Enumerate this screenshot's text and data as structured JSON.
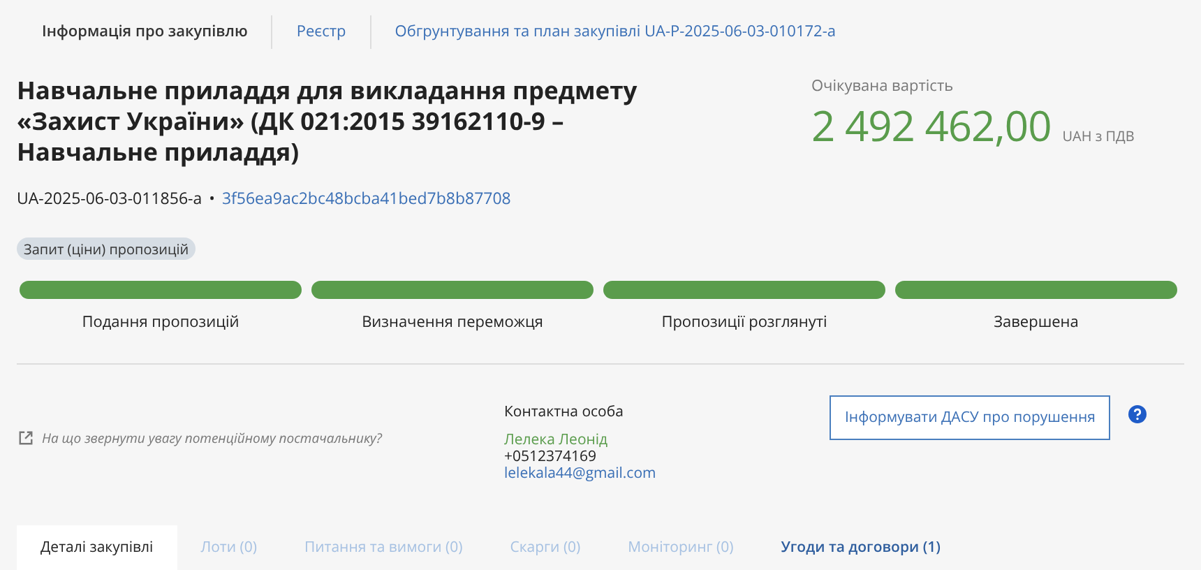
{
  "top_tabs": [
    {
      "label": "Інформація про закупівлю",
      "selected": true
    },
    {
      "label": "Реєстр",
      "selected": false
    },
    {
      "label": "Обгрунтування та план закупівлі UA-P-2025-06-03-010172-a",
      "selected": false
    }
  ],
  "title": "Навчальне приладдя для викладання предмету «Захист України» (ДК 021:2015 39162110-9 – Навчальне приладдя)",
  "tender_id": "UA-2025-06-03-011856-a",
  "separator": "•",
  "hash": "3f56ea9ac2bc48bcba41bed7b8b87708",
  "procedure": "Запит (ціни) пропозицій",
  "value": {
    "label": "Очікувана вартість",
    "amount": "2 492 462,00",
    "currency": "UAH з ПДВ"
  },
  "stages": [
    {
      "label": "Подання пропозицій",
      "done": true
    },
    {
      "label": "Визначення переможця",
      "done": true
    },
    {
      "label": "Пропозиції розглянуті",
      "done": true
    },
    {
      "label": "Завершена",
      "done": true
    }
  ],
  "hint_link": "На що звернути увагу потенційному постачальнику?",
  "contact": {
    "heading": "Контактна особа",
    "name": "Лелека Леонід",
    "phone": "+0512374169",
    "email": "lelekala44@gmail.com"
  },
  "report_button": "Інформувати ДАСУ про порушення",
  "bottom_tabs": [
    {
      "label": "Деталі закупівлі",
      "selected": true,
      "disabled": false
    },
    {
      "label": "Лоти (0)",
      "selected": false,
      "disabled": true
    },
    {
      "label": "Питання та вимоги (0)",
      "selected": false,
      "disabled": true
    },
    {
      "label": "Скарги (0)",
      "selected": false,
      "disabled": true
    },
    {
      "label": "Моніторинг (0)",
      "selected": false,
      "disabled": true
    },
    {
      "label": "Угоди та договори (1)",
      "selected": false,
      "disabled": false
    }
  ]
}
